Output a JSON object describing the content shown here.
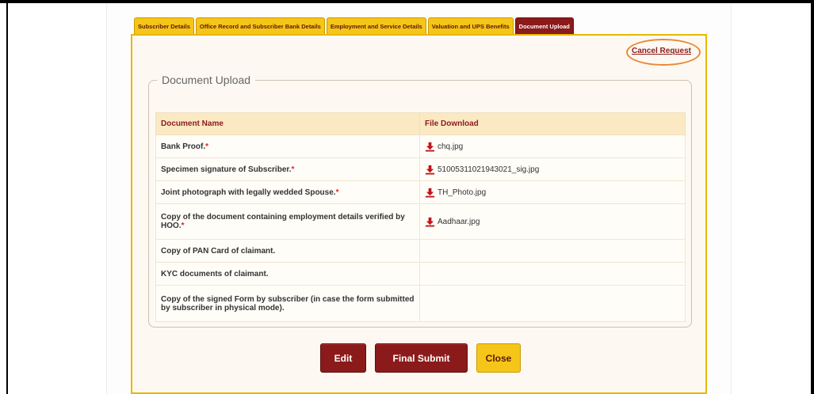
{
  "tabs": [
    {
      "label": "Subscriber Details",
      "active": false
    },
    {
      "label": "Office Record and Subscriber Bank Details",
      "active": false
    },
    {
      "label": "Employment and Service Details",
      "active": false
    },
    {
      "label": "Valuation and UPS Benefits",
      "active": false
    },
    {
      "label": "Document Upload",
      "active": true
    }
  ],
  "cancel_request": "Cancel Request",
  "section_title": "Document Upload",
  "table": {
    "headers": [
      "Document Name",
      "File Download"
    ],
    "rows": [
      {
        "name": "Bank Proof.",
        "required": "*",
        "file": "chq.jpg"
      },
      {
        "name": "Specimen signature of Subscriber.",
        "required": "*",
        "file": "51005311021943021_sig.jpg"
      },
      {
        "name": "Joint photograph with legally wedded Spouse.",
        "required": "*",
        "file": "TH_Photo.jpg"
      },
      {
        "name": "Copy of the document containing employment details verified by HOO.",
        "required": "*",
        "file": "Aadhaar.jpg"
      },
      {
        "name": "Copy of PAN Card of claimant.",
        "required": "",
        "file": ""
      },
      {
        "name": "KYC documents of claimant.",
        "required": "",
        "file": ""
      },
      {
        "name": "Copy of the signed Form by subscriber (in case the form submitted by subscriber in physical mode).",
        "required": "",
        "file": ""
      }
    ]
  },
  "buttons": {
    "edit": "Edit",
    "final_submit": "Final Submit",
    "close": "Close"
  },
  "icons": {
    "download": "download-icon"
  },
  "colors": {
    "primary": "#8b1a1a",
    "accent": "#f5c518",
    "highlight_ring": "#e8893a",
    "header_bg": "#fbe9c4"
  }
}
